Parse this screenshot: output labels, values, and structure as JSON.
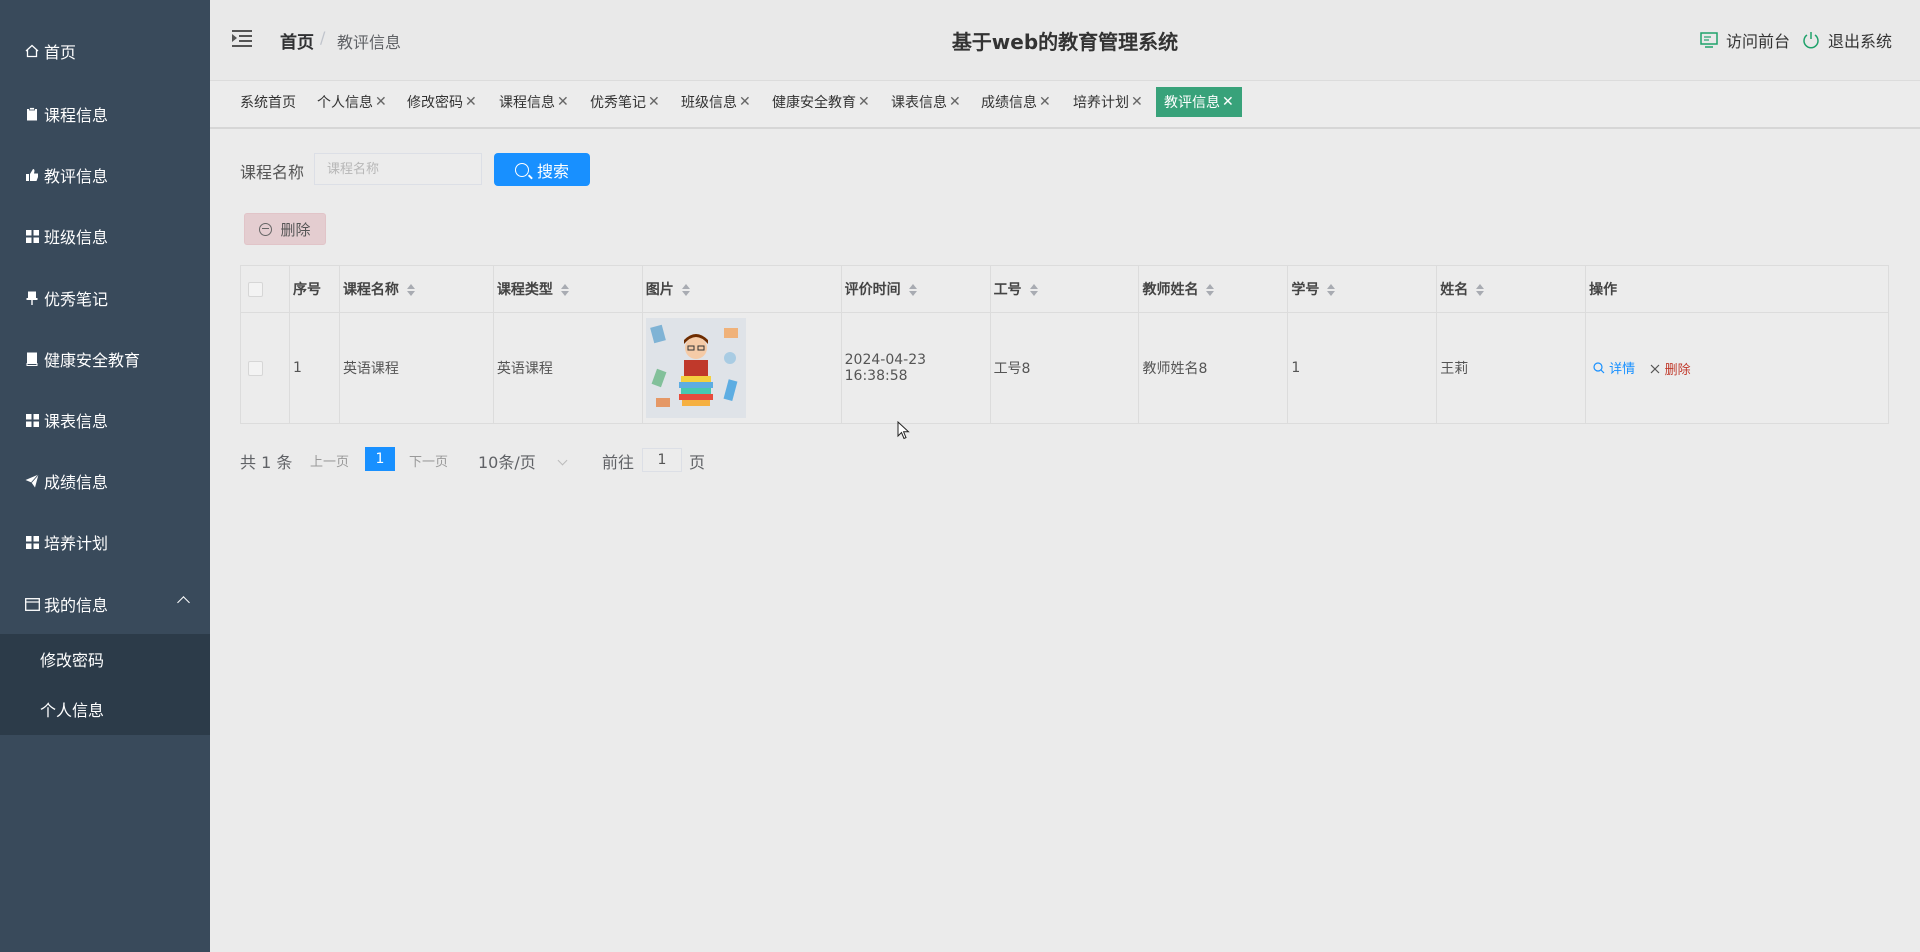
{
  "sidebar": {
    "items": [
      {
        "label": "首页",
        "icon": "home-icon"
      },
      {
        "label": "课程信息",
        "icon": "clipboard-icon"
      },
      {
        "label": "教评信息",
        "icon": "thumbs-up-icon"
      },
      {
        "label": "班级信息",
        "icon": "grid-icon"
      },
      {
        "label": "优秀笔记",
        "icon": "pin-icon"
      },
      {
        "label": "健康安全教育",
        "icon": "book-icon"
      },
      {
        "label": "课表信息",
        "icon": "grid-icon"
      },
      {
        "label": "成绩信息",
        "icon": "send-icon"
      },
      {
        "label": "培养计划",
        "icon": "grid-icon"
      },
      {
        "label": "我的信息",
        "icon": "user-card-icon"
      }
    ],
    "submenu": [
      {
        "label": "修改密码"
      },
      {
        "label": "个人信息"
      }
    ]
  },
  "header": {
    "breadcrumb_home": "首页",
    "breadcrumb_sep": "/",
    "breadcrumb_current": "教评信息",
    "title": "基于web的教育管理系统",
    "visit_front": "访问前台",
    "logout": "退出系统"
  },
  "tabs": [
    {
      "label": "系统首页",
      "closable": false
    },
    {
      "label": "个人信息",
      "closable": true
    },
    {
      "label": "修改密码",
      "closable": true
    },
    {
      "label": "课程信息",
      "closable": true
    },
    {
      "label": "优秀笔记",
      "closable": true
    },
    {
      "label": "班级信息",
      "closable": true
    },
    {
      "label": "健康安全教育",
      "closable": true
    },
    {
      "label": "课表信息",
      "closable": true
    },
    {
      "label": "成绩信息",
      "closable": true
    },
    {
      "label": "培养计划",
      "closable": true
    },
    {
      "label": "教评信息",
      "closable": true,
      "active": true
    }
  ],
  "search": {
    "label": "课程名称",
    "placeholder": "课程名称",
    "button": "搜索"
  },
  "actions": {
    "delete": "删除"
  },
  "table": {
    "columns": [
      "序号",
      "课程名称",
      "课程类型",
      "图片",
      "评价时间",
      "工号",
      "教师姓名",
      "学号",
      "姓名",
      "操作"
    ],
    "rows": [
      {
        "index": "1",
        "course_name": "英语课程",
        "course_type": "英语课程",
        "eval_time": "2024-04-23 16:38:58",
        "staff_no": "工号8",
        "teacher_name": "教师姓名8",
        "student_no": "1",
        "name": "王莉",
        "op_detail": "详情",
        "op_delete": "删除"
      }
    ]
  },
  "pagination": {
    "total": "共 1 条",
    "prev": "上一页",
    "current": "1",
    "next": "下一页",
    "page_size": "10条/页",
    "goto_label": "前往",
    "goto_value": "1",
    "goto_suffix": "页"
  },
  "colors": {
    "sidebar_bg": "#394a5b",
    "submenu_bg": "#2c3b49",
    "active_tab": "#38a27a",
    "primary": "#1890ff",
    "danger": "#d9534f",
    "header_icon": "#1fa26b"
  }
}
